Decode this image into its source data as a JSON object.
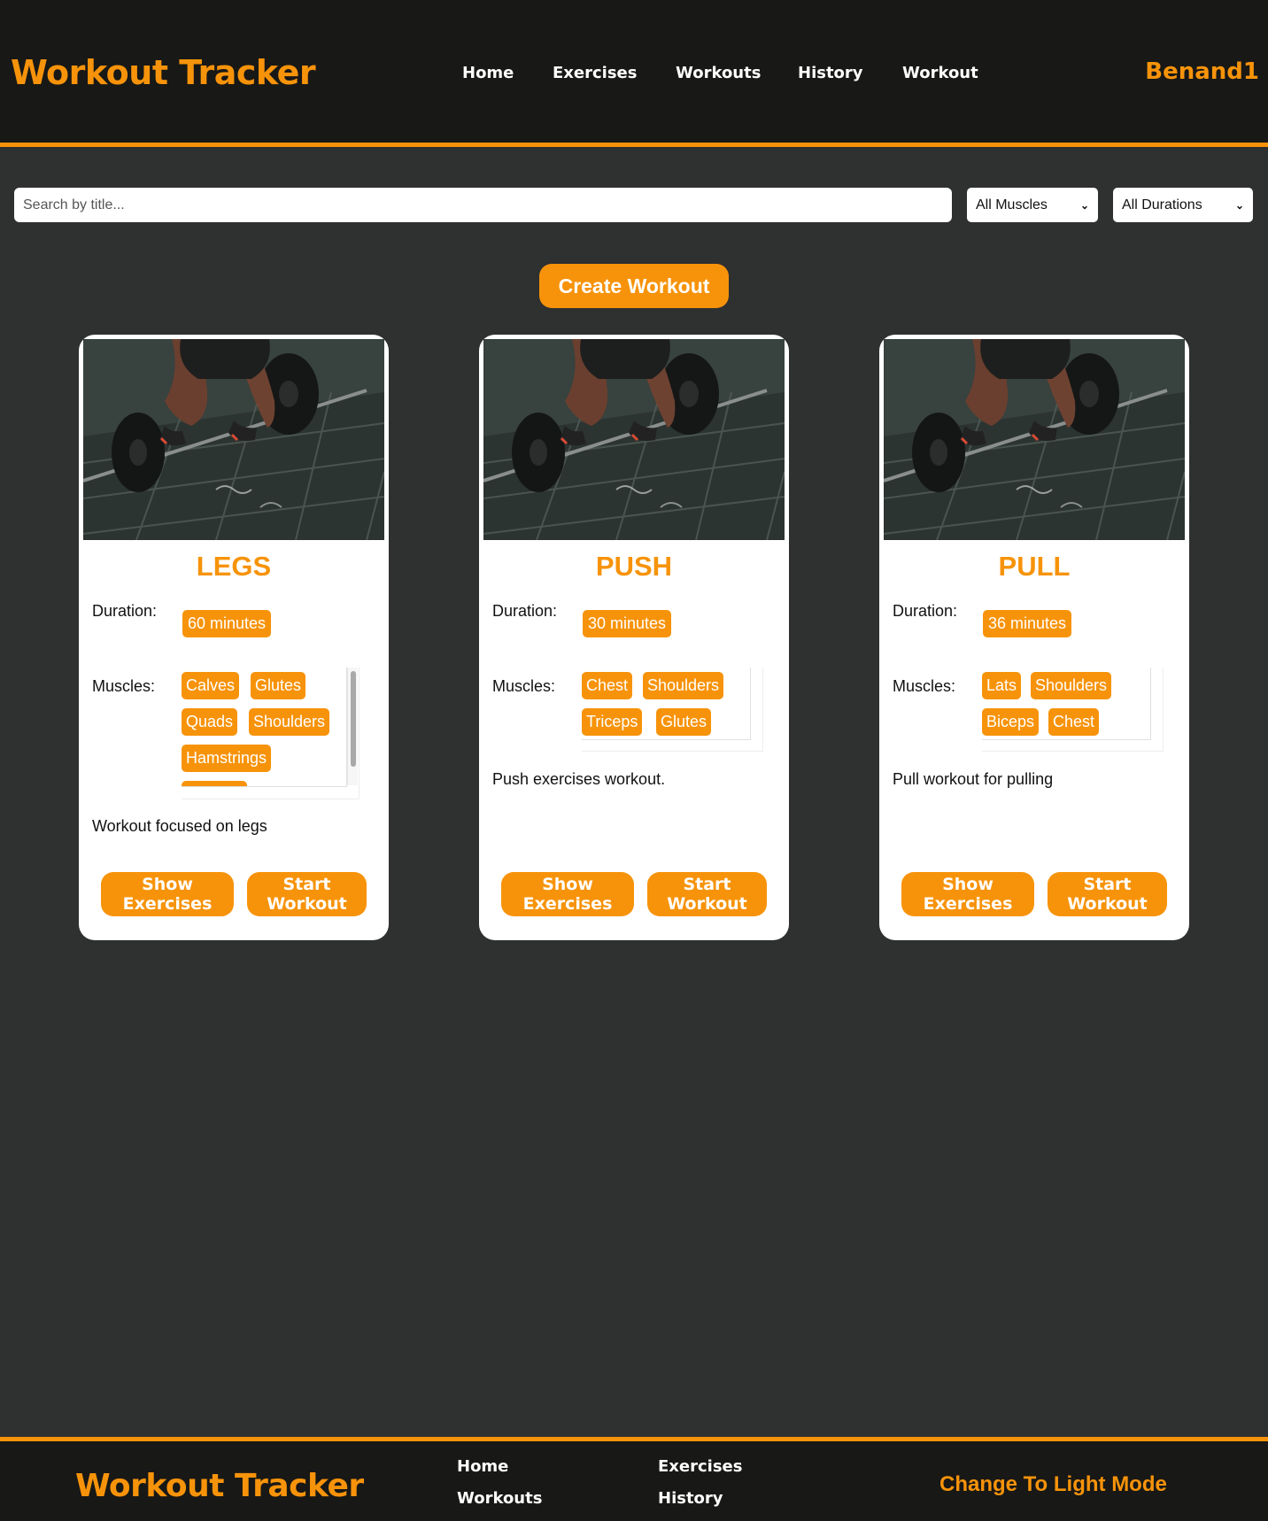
{
  "header": {
    "brand": "Workout Tracker",
    "nav": [
      "Home",
      "Exercises",
      "Workouts",
      "History",
      "Workout"
    ],
    "user": "Benand1"
  },
  "filters": {
    "search_placeholder": "Search by title...",
    "muscles_selected": "All Muscles",
    "durations_selected": "All Durations"
  },
  "create_label": "Create Workout",
  "cards": [
    {
      "title": "LEGS",
      "duration_label": "Duration:",
      "duration": "60 minutes",
      "muscles_label": "Muscles:",
      "muscles": [
        "Calves",
        "Glutes",
        "Quads",
        "Shoulders",
        "Hamstrings"
      ],
      "description": "Workout focused on legs",
      "show_label": "Show Exercises",
      "start_label": "Start Workout"
    },
    {
      "title": "PUSH",
      "duration_label": "Duration:",
      "duration": "30 minutes",
      "muscles_label": "Muscles:",
      "muscles": [
        "Chest",
        "Shoulders",
        "Triceps",
        "Glutes"
      ],
      "description": "Push exercises workout.",
      "show_label": "Show Exercises",
      "start_label": "Start Workout"
    },
    {
      "title": "PULL",
      "duration_label": "Duration:",
      "duration": "36 minutes",
      "muscles_label": "Muscles:",
      "muscles": [
        "Lats",
        "Shoulders",
        "Biceps",
        "Chest"
      ],
      "description": "Pull workout for pulling",
      "show_label": "Show Exercises",
      "start_label": "Start Workout"
    }
  ],
  "footer": {
    "brand": "Workout Tracker",
    "links": [
      "Home",
      "Exercises",
      "Workouts",
      "History"
    ],
    "mode_toggle": "Change To Light Mode"
  },
  "colors": {
    "accent": "#f7930a",
    "header_bg": "#181816",
    "page_bg": "#2f3030"
  }
}
